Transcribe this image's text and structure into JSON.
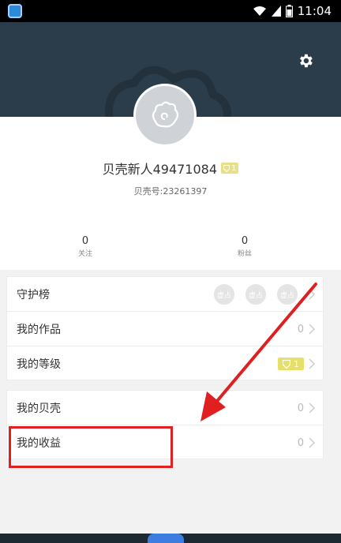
{
  "status_bar": {
    "time": "11:04",
    "icons": [
      "app-icon",
      "wifi-icon",
      "signal-icon",
      "battery-icon"
    ]
  },
  "header": {
    "settings_icon": "gear-icon",
    "background_color": "#2b3c4b"
  },
  "profile": {
    "avatar_icon": "shell-avatar-icon",
    "username": "贝壳新人49471084",
    "level": "1",
    "account_id": "贝壳号:23261397"
  },
  "stats": {
    "follow": {
      "value": "0",
      "label": "关注"
    },
    "fans": {
      "value": "0",
      "label": "粉丝"
    }
  },
  "menu": {
    "guard_list": {
      "label": "守护榜",
      "slots": [
        "虚占",
        "虚占",
        "虚占"
      ]
    },
    "my_works": {
      "label": "我的作品",
      "count": "0"
    },
    "my_level": {
      "label": "我的等级",
      "level": "1"
    },
    "my_shells": {
      "label": "我的贝壳",
      "count": "0"
    },
    "my_earnings": {
      "label": "我的收益",
      "count": "0"
    }
  },
  "colors": {
    "header": "#2b3c4b",
    "level_badge": "#e6df6a",
    "highlight": "#e02020",
    "text": "#333333"
  }
}
